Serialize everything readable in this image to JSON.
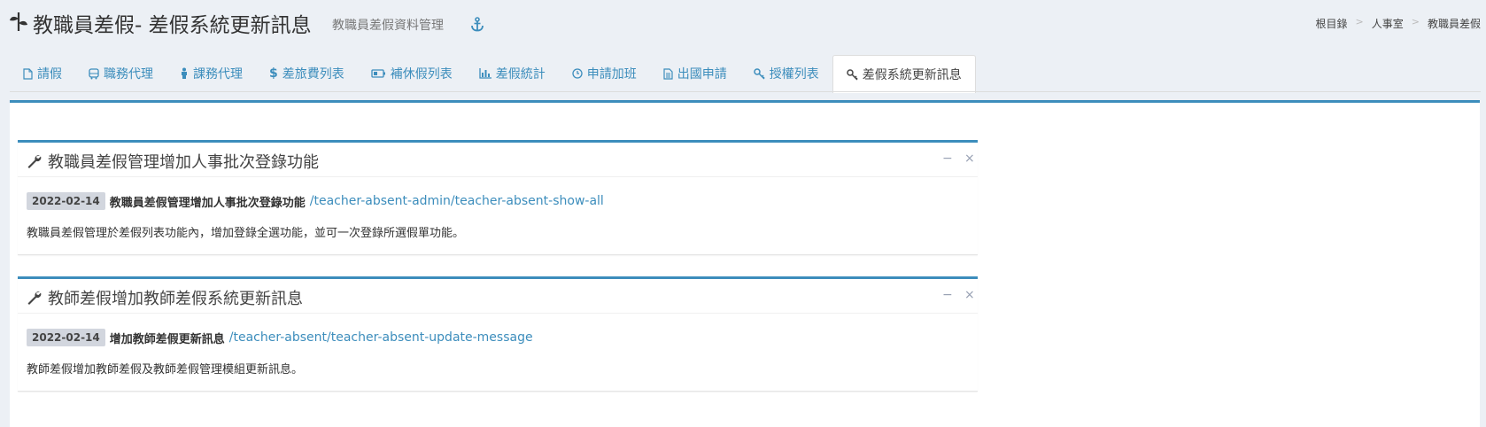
{
  "header": {
    "title": "教職員差假- 差假系統更新訊息",
    "subtitle": "教職員差假資料管理",
    "breadcrumb": [
      "根目錄",
      "人事室",
      "教職員差假"
    ],
    "breadcrumb_sep": ">"
  },
  "tabs": [
    {
      "label": "請假",
      "icon": "file-icon"
    },
    {
      "label": "職務代理",
      "icon": "bus-icon"
    },
    {
      "label": "課務代理",
      "icon": "person-icon"
    },
    {
      "label": "差旅費列表",
      "icon": "dollar-icon"
    },
    {
      "label": "補休假列表",
      "icon": "battery-icon"
    },
    {
      "label": "差假統計",
      "icon": "bar-chart-icon"
    },
    {
      "label": "申請加班",
      "icon": "clock-icon"
    },
    {
      "label": "出國申請",
      "icon": "document-icon"
    },
    {
      "label": "授權列表",
      "icon": "key-icon"
    },
    {
      "label": "差假系統更新訊息",
      "icon": "key-icon",
      "active": true
    }
  ],
  "boxes": [
    {
      "title": "教職員差假管理增加人事批次登錄功能",
      "date": "2022-02-14",
      "item_title": "教職員差假管理增加人事批次登錄功能",
      "link": "/teacher-absent-admin/teacher-absent-show-all",
      "description": "教職員差假管理於差假列表功能內，增加登錄全選功能，並可一次登錄所選假單功能。",
      "minimize": "−",
      "close": "×"
    },
    {
      "title": "教師差假增加教師差假系統更新訊息",
      "date": "2022-02-14",
      "item_title": "增加教師差假更新訊息",
      "link": "/teacher-absent/teacher-absent-update-message",
      "description": "教師差假增加教師差假及教師差假管理模組更新訊息。",
      "minimize": "−",
      "close": "×"
    }
  ],
  "colors": {
    "accent": "#3c8dbc",
    "badge": "#d2d6de"
  }
}
